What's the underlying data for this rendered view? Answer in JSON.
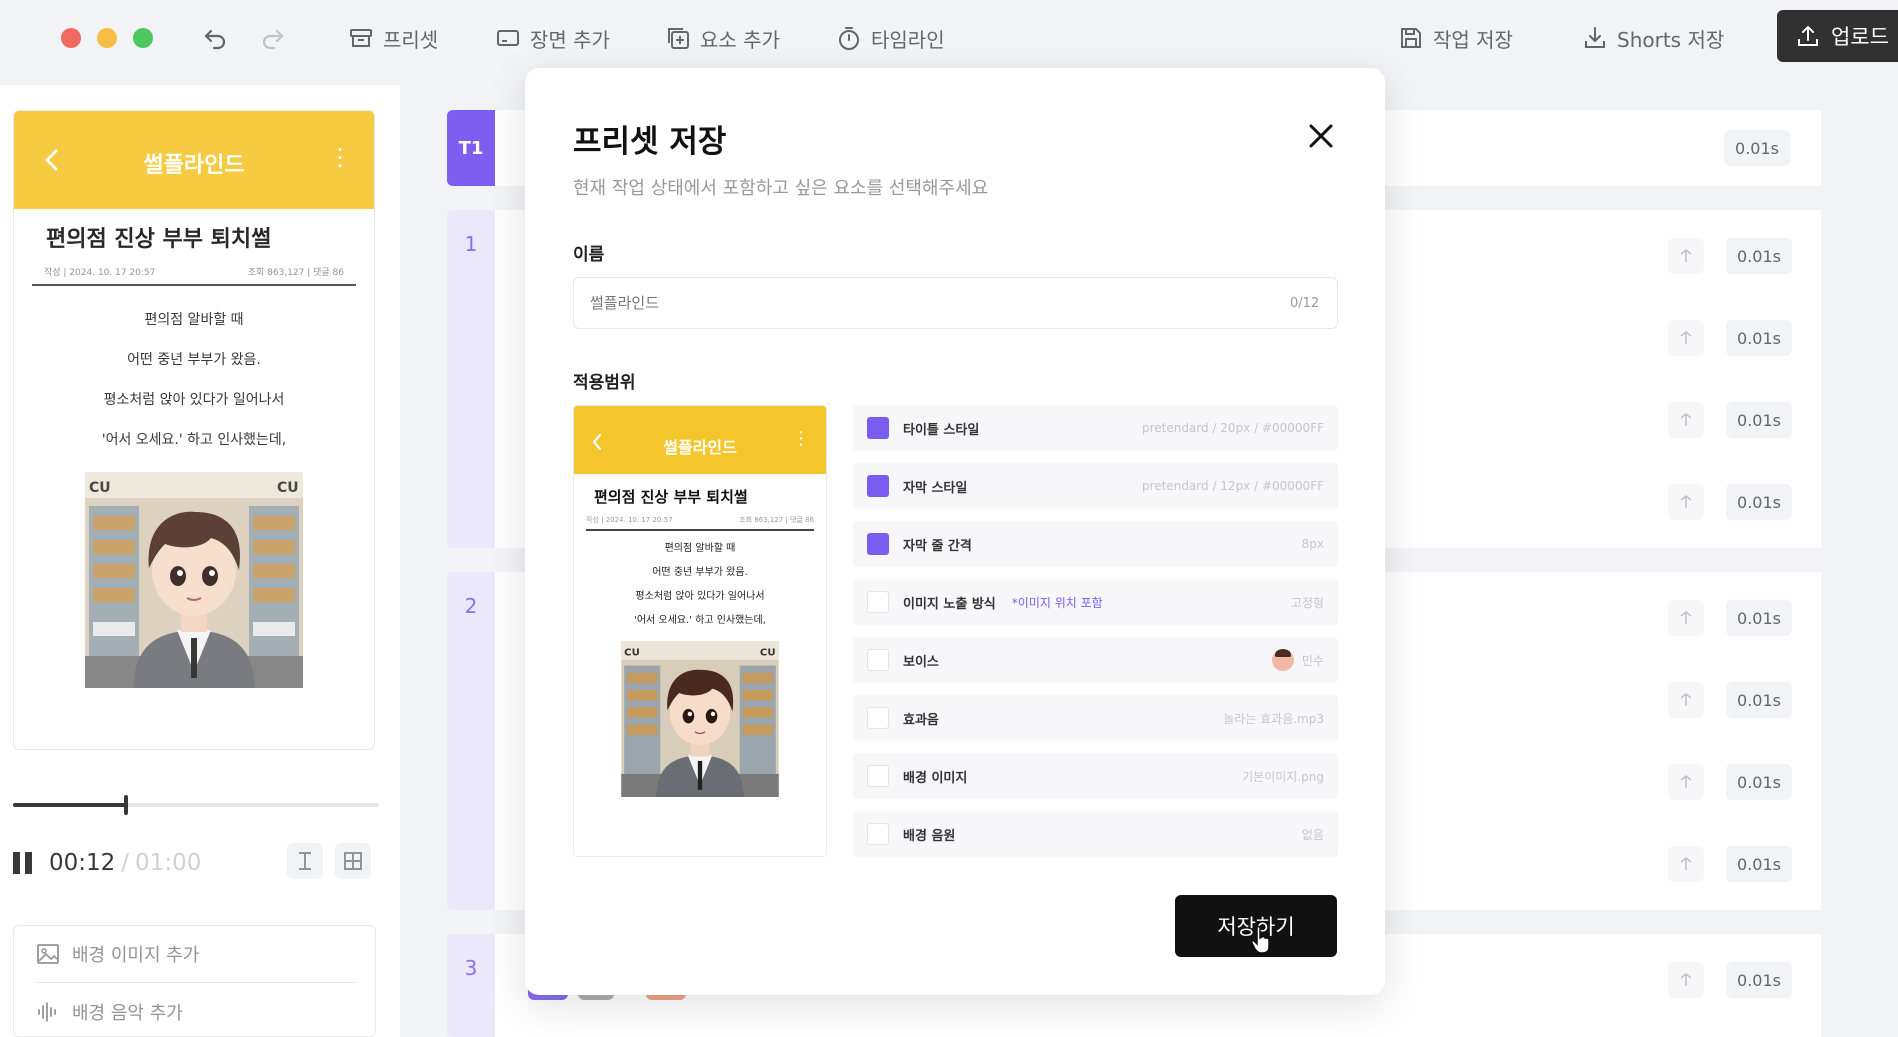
{
  "toolbar": {
    "undo_icon": "undo-icon",
    "redo_icon": "redo-icon",
    "preset": "프리셋",
    "add_scene": "장면 추가",
    "add_element": "요소 추가",
    "timeline": "타임라인",
    "save_work": "작업 저장",
    "shorts_save": "Shorts 저장",
    "upload": "업로드"
  },
  "preview": {
    "header_title": "썰플라인드",
    "post_title": "편의점 진상 부부 퇴치썰",
    "meta_left": "작성 | 2024. 10. 17 20:57",
    "meta_right": "조회 863,127 | 댓글 86",
    "lines": [
      "편의점 알바할 때",
      "어떤 중년 부부가 왔음.",
      "평소처럼 앉아 있다가 일어나서",
      "'어서 오세요.' 하고 인사했는데,"
    ],
    "store_sign": "CU",
    "progress": 0.31,
    "time_current": "00:12",
    "time_separator": "/",
    "time_total": "01:00"
  },
  "left_actions": {
    "add_bg_image": "배경 이미지 추가",
    "add_bg_music": "배경 음악 추가"
  },
  "timeline": {
    "title_tab": "T1",
    "scenes": [
      "1",
      "2",
      "3"
    ],
    "durations": [
      "0.01s",
      "0.01s",
      "0.01s",
      "0.01s",
      "0.01s",
      "0.01s",
      "0.01s",
      "0.01s",
      "0.01s",
      "0.01s"
    ]
  },
  "modal": {
    "title": "프리셋 저장",
    "subtitle": "현재 작업 상태에서 포함하고 싶은 요소를 선택해주세요",
    "name_label": "이름",
    "name_placeholder": "썰플라인드",
    "name_count": "0/12",
    "scope_label": "적용범위",
    "options": [
      {
        "label": "타이틀 스타일",
        "value": "pretendard / 20px / #00000FF",
        "checked": true
      },
      {
        "label": "자막 스타일",
        "value": "pretendard / 12px / #00000FF",
        "checked": true
      },
      {
        "label": "자막 줄 간격",
        "value": "8px",
        "checked": true
      },
      {
        "label": "이미지 노출 방식",
        "extra": "*이미지 위치 포함",
        "value": "고정형",
        "checked": false
      },
      {
        "label": "보이스",
        "value": "민수",
        "checked": false
      },
      {
        "label": "효과음",
        "value": "놀라는 효과음.mp3",
        "checked": false
      },
      {
        "label": "배경 이미지",
        "value": "기본이미지.png",
        "checked": false
      },
      {
        "label": "배경 음원",
        "value": "없음",
        "checked": false
      }
    ],
    "save_button": "저장하기"
  },
  "colors": {
    "accent": "#7b5cf0",
    "brand_yellow": "#f5c52c",
    "dark": "#111111"
  }
}
